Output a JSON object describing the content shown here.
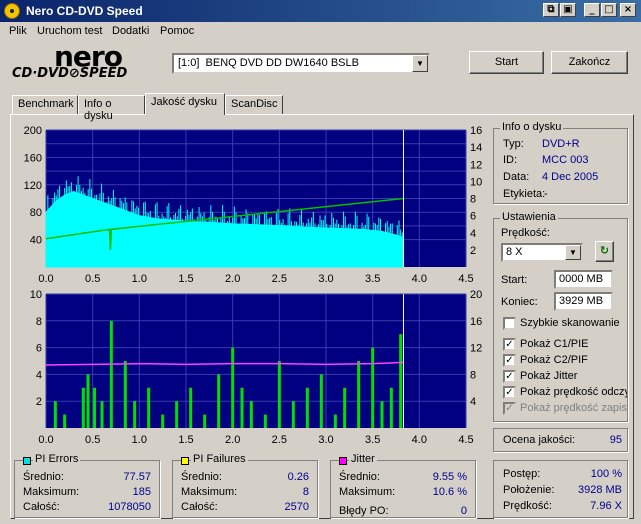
{
  "window": {
    "title": "Nero CD-DVD Speed"
  },
  "menu": [
    "Plik",
    "Uruchom test",
    "Dodatki",
    "Pomoc"
  ],
  "logo": {
    "brand": "nero",
    "subtitle": "CD·DVD⊘SPEED"
  },
  "drive": {
    "selected": "[1:0]  BENQ DVD DD DW1640 BSLB"
  },
  "buttons": {
    "start": "Start",
    "finish": "Zakończ"
  },
  "tabs": [
    "Benchmark",
    "Info o dysku",
    "Jakość dysku",
    "ScanDisc"
  ],
  "active_tab": 2,
  "disc_info": {
    "title": "Info o dysku",
    "type_label": "Typ:",
    "type": "DVD+R",
    "id_label": "ID:",
    "id": "MCC 003",
    "date_label": "Data:",
    "date": "4 Dec 2005",
    "label_label": "Etykieta:",
    "label": "-"
  },
  "settings": {
    "title": "Ustawienia",
    "speed_label": "Prędkość:",
    "speed": "8 X",
    "start_label": "Start:",
    "start": "0000 MB",
    "end_label": "Koniec:",
    "end": "3929 MB",
    "options": [
      {
        "label": "Szybkie skanowanie",
        "checked": false,
        "disabled": false
      },
      {
        "label": "Pokaż C1/PIE",
        "checked": true,
        "disabled": false
      },
      {
        "label": "Pokaż C2/PIF",
        "checked": true,
        "disabled": false
      },
      {
        "label": "Pokaż Jitter",
        "checked": true,
        "disabled": false
      },
      {
        "label": "Pokaż prędkość odczytu",
        "checked": true,
        "disabled": false
      },
      {
        "label": "Pokaż prędkość zapisu",
        "checked": true,
        "disabled": true
      }
    ]
  },
  "quality": {
    "label": "Ocena jakości:",
    "value": "95"
  },
  "pi_errors": {
    "title": "PI Errors",
    "color": "#00e0e0",
    "avg_label": "Średnio:",
    "avg": "77.57",
    "max_label": "Maksimum:",
    "max": "185",
    "total_label": "Całość:",
    "total": "1078050"
  },
  "pi_failures": {
    "title": "PI Failures",
    "color": "#ffff00",
    "avg_label": "Średnio:",
    "avg": "0.26",
    "max_label": "Maksimum:",
    "max": "8",
    "total_label": "Całość:",
    "total": "2570"
  },
  "jitter": {
    "title": "Jitter",
    "color": "#ff00ff",
    "avg_label": "Średnio:",
    "avg": "9.55 %",
    "max_label": "Maksimum:",
    "max": "10.6 %",
    "po_label": "Błędy PO:",
    "po": "0"
  },
  "progress": {
    "progress_label": "Postęp:",
    "progress": "100 %",
    "position_label": "Położenie:",
    "position": "3928 MB",
    "speed_label": "Prędkość:",
    "speed": "7.96 X"
  },
  "chart_data": [
    {
      "type": "area",
      "title": "",
      "xlim": [
        0,
        4.5
      ],
      "ylim_left": [
        0,
        200
      ],
      "ylim_right": [
        0,
        16
      ],
      "x_ticks": [
        "0.0",
        "0.5",
        "1.0",
        "1.5",
        "2.0",
        "2.5",
        "3.0",
        "3.5",
        "4.0",
        "4.5"
      ],
      "y_ticks_left": [
        "40",
        "60",
        "80",
        "100",
        "120",
        "140",
        "160",
        "180",
        "200"
      ],
      "y_ticks_left_shown": [
        "40",
        "80",
        "120",
        "160",
        "200"
      ],
      "y_ticks_right": [
        "2",
        "4",
        "6",
        "8",
        "10",
        "12",
        "14",
        "16"
      ],
      "grid": true,
      "background": "#000080",
      "series": [
        {
          "name": "PI Errors",
          "color": "#00ffff",
          "x": [
            0.0,
            0.1,
            0.2,
            0.3,
            0.4,
            0.5,
            0.6,
            0.7,
            0.8,
            0.9,
            1.0,
            1.2,
            1.4,
            1.6,
            1.8,
            2.0,
            2.2,
            2.4,
            2.6,
            2.8,
            3.0,
            3.2,
            3.4,
            3.6,
            3.8,
            3.83
          ],
          "values": [
            80,
            95,
            105,
            110,
            105,
            100,
            95,
            90,
            85,
            80,
            75,
            70,
            68,
            66,
            65,
            63,
            62,
            61,
            60,
            58,
            57,
            56,
            55,
            52,
            45,
            40
          ]
        },
        {
          "name": "Read speed",
          "color": "#00c000",
          "axis": "right",
          "x": [
            0.0,
            0.68,
            0.69,
            0.7,
            3.83
          ],
          "values": [
            3.3,
            4.4,
            2.0,
            4.4,
            8.0
          ]
        }
      ]
    },
    {
      "type": "bar",
      "title": "",
      "xlim": [
        0,
        4.5
      ],
      "ylim_left": [
        0,
        10
      ],
      "ylim_right": [
        0,
        20
      ],
      "x_ticks": [
        "0.0",
        "0.5",
        "1.0",
        "1.5",
        "2.0",
        "2.5",
        "3.0",
        "3.5",
        "4.0",
        "4.5"
      ],
      "y_ticks_left": [
        "2",
        "4",
        "6",
        "8",
        "10"
      ],
      "y_ticks_right": [
        "4",
        "8",
        "12",
        "16",
        "20"
      ],
      "grid": true,
      "background": "#000080",
      "series": [
        {
          "name": "PI Failures",
          "color": "#00e000",
          "x": [
            0.1,
            0.2,
            0.4,
            0.45,
            0.52,
            0.6,
            0.7,
            0.85,
            0.95,
            1.1,
            1.25,
            1.4,
            1.55,
            1.7,
            1.85,
            2.0,
            2.1,
            2.2,
            2.35,
            2.5,
            2.65,
            2.8,
            2.95,
            3.1,
            3.2,
            3.35,
            3.5,
            3.6,
            3.7,
            3.8
          ],
          "values": [
            2,
            1,
            3,
            4,
            3,
            2,
            8,
            5,
            2,
            3,
            1,
            2,
            3,
            1,
            4,
            6,
            3,
            2,
            1,
            5,
            2,
            3,
            4,
            1,
            3,
            5,
            6,
            2,
            3,
            7
          ]
        },
        {
          "name": "Jitter",
          "color": "#ff40ff",
          "axis": "right",
          "x": [
            0.0,
            0.5,
            1.0,
            1.5,
            2.0,
            2.5,
            3.0,
            3.5,
            3.83
          ],
          "values": [
            9.4,
            9.5,
            9.6,
            9.5,
            9.6,
            9.6,
            9.5,
            9.6,
            9.8
          ]
        }
      ]
    }
  ]
}
